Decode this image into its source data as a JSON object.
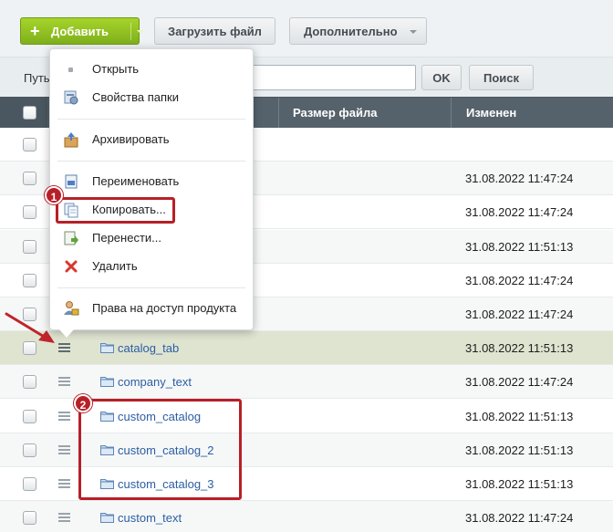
{
  "toolbar": {
    "add_label": "Добавить",
    "upload_label": "Загрузить файл",
    "more_label": "Дополнительно"
  },
  "path_bar": {
    "label": "Путь",
    "input_value": "",
    "ok_label": "OK",
    "search_label": "Поиск"
  },
  "table": {
    "columns": {
      "size": "Размер файла",
      "modified": "Изменен"
    },
    "rows": [
      {
        "name": "",
        "modified": ""
      },
      {
        "name": "",
        "modified": "31.08.2022 11:47:24"
      },
      {
        "name": "",
        "modified": "31.08.2022 11:47:24"
      },
      {
        "name": "",
        "modified": "31.08.2022 11:51:13"
      },
      {
        "name": "",
        "modified": "31.08.2022 11:47:24"
      },
      {
        "name": "",
        "modified": "31.08.2022 11:47:24"
      },
      {
        "name": "catalog_tab",
        "modified": "31.08.2022 11:51:13"
      },
      {
        "name": "company_text",
        "modified": "31.08.2022 11:47:24"
      },
      {
        "name": "custom_catalog",
        "modified": "31.08.2022 11:51:13"
      },
      {
        "name": "custom_catalog_2",
        "modified": "31.08.2022 11:51:13"
      },
      {
        "name": "custom_catalog_3",
        "modified": "31.08.2022 11:51:13"
      },
      {
        "name": "custom_text",
        "modified": "31.08.2022 11:47:24"
      }
    ]
  },
  "context_menu": {
    "items": [
      {
        "label": "Открыть",
        "icon": "dot-icon"
      },
      {
        "label": "Свойства папки",
        "icon": "folder-properties-icon"
      },
      {
        "label": "Архивировать",
        "icon": "archive-box-icon"
      },
      {
        "label": "Переименовать",
        "icon": "rename-icon"
      },
      {
        "label": "Копировать...",
        "icon": "copy-icon"
      },
      {
        "label": "Перенести...",
        "icon": "move-icon"
      },
      {
        "label": "Удалить",
        "icon": "delete-x-icon"
      },
      {
        "label": "Права на доступ продукта",
        "icon": "user-lock-icon"
      }
    ]
  },
  "annotations": {
    "step1": "1",
    "step2": "2"
  },
  "colors": {
    "accent_green": "#8cc21f",
    "header_bg": "#56626b",
    "highlight_row": "#dfe4d0",
    "annotation_red": "#b72027",
    "link_blue": "#2c5ea3"
  }
}
